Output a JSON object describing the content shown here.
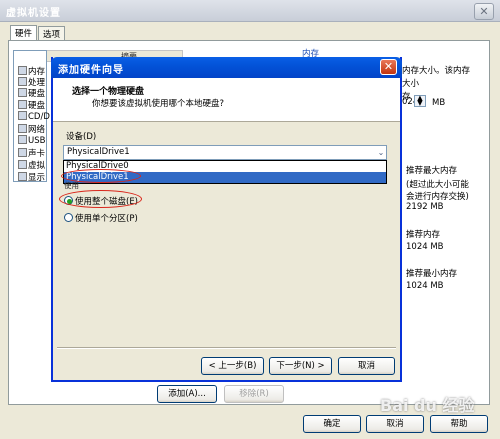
{
  "outer": {
    "title": "虚拟机设置",
    "close_glyph": "✕",
    "tabs": [
      "硬件",
      "选项"
    ],
    "device_header": {
      "col1": "设备",
      "col2": "摘要"
    },
    "devices": [
      "内存",
      "处理",
      "硬盘",
      "硬盘",
      "CD/D",
      "网络",
      "USB",
      "声卡",
      "虚拟",
      "显示"
    ],
    "right": {
      "group_title": "内存",
      "desc1": "内存大小。该内存",
      "desc2": "大小",
      "desc3": "存",
      "mem_value": "024",
      "mem_unit": "MB",
      "max_rec_label": "推荐最大内存",
      "max_rec_note1": "(超过此大小可能",
      "max_rec_note2": "会进行内存交换)",
      "max_rec_value": "2192 MB",
      "rec_label": "推荐内存",
      "rec_value": "1024 MB",
      "min_label": "推荐最小内存",
      "min_value": "1024 MB"
    },
    "add_button": "添加(A)...",
    "remove_button": "移除(R)",
    "ok_button": "确定",
    "cancel_button": "取消",
    "help_button": "帮助"
  },
  "wizard": {
    "title": "添加硬件向导",
    "close_glyph": "✕",
    "header_title": "选择一个物理硬盘",
    "header_sub": "你想要该虚拟机使用哪个本地硬盘?",
    "device_label": "设备(D)",
    "combo_value": "PhysicalDrive1",
    "combo_arrow": "⌄",
    "options": [
      "PhysicalDrive0",
      "PhysicalDrive1"
    ],
    "usage_label": "使用",
    "radio_whole": "使用整个磁盘(E)",
    "radio_partition": "使用单个分区(P)",
    "back_button": "< 上一步(B)",
    "next_button": "下一步(N) >",
    "cancel_button": "取消"
  },
  "watermark": "Bai du 经验",
  "colors": {
    "title_blue": "#0a5fe6",
    "selection": "#316ac5",
    "annotation": "#d9271c"
  }
}
